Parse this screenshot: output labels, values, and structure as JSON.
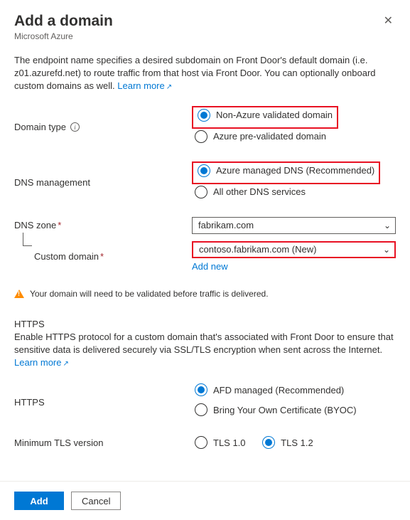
{
  "header": {
    "title": "Add a domain",
    "subtitle": "Microsoft Azure"
  },
  "intro": {
    "text": "The endpoint name specifies a desired subdomain on Front Door's default domain (i.e. z01.azurefd.net) to route traffic from that host via Front Door. You can optionally onboard custom domains as well.",
    "learn_more": "Learn more"
  },
  "fields": {
    "domain_type": {
      "label": "Domain type"
    },
    "dns_management": {
      "label": "DNS management"
    },
    "dns_zone": {
      "label": "DNS zone",
      "value": "fabrikam.com"
    },
    "custom_domain": {
      "label": "Custom domain",
      "value": "contoso.fabrikam.com (New)",
      "add_new": "Add new"
    },
    "https_toggle": {
      "label": "HTTPS"
    },
    "min_tls": {
      "label": "Minimum TLS version"
    }
  },
  "radios": {
    "domain_type": {
      "opt1": "Non-Azure validated domain",
      "opt2": "Azure pre-validated domain"
    },
    "dns_mgmt": {
      "opt1": "Azure managed DNS (Recommended)",
      "opt2": "All other DNS services"
    },
    "https": {
      "opt1": "AFD managed (Recommended)",
      "opt2": "Bring Your Own Certificate (BYOC)"
    },
    "tls": {
      "opt1": "TLS 1.0",
      "opt2": "TLS 1.2"
    }
  },
  "warning": "Your domain will need to be validated before traffic is delivered.",
  "https_section": {
    "heading": "HTTPS",
    "desc": "Enable HTTPS protocol for a custom domain that's associated with Front Door to ensure that sensitive data is delivered securely via SSL/TLS encryption when sent across the Internet.",
    "learn_more": "Learn more"
  },
  "footer": {
    "add": "Add",
    "cancel": "Cancel"
  }
}
